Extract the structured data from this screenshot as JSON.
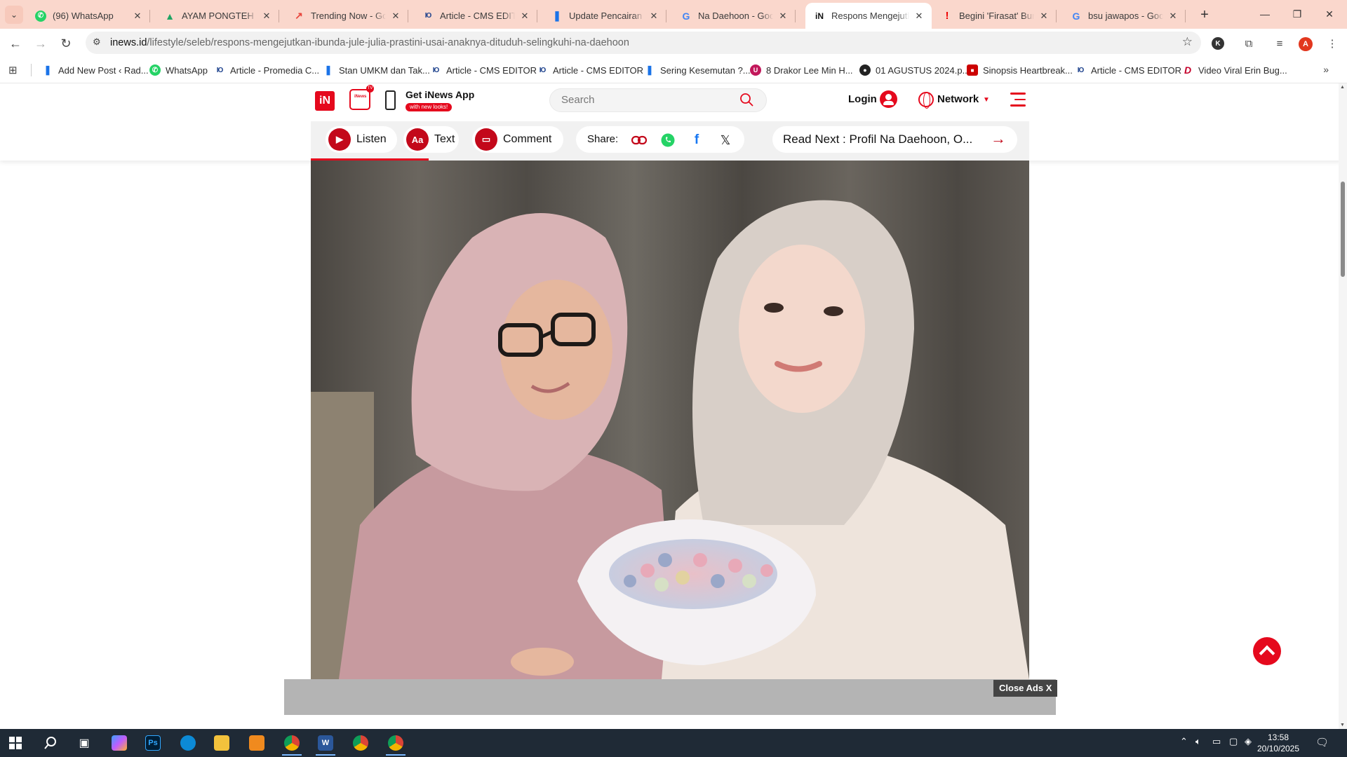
{
  "browser": {
    "tabs": [
      {
        "title": "(96) WhatsApp",
        "favicon": "whatsapp-icon",
        "active": false
      },
      {
        "title": "AYAM PONGTEH - Go",
        "favicon": "google-drive-icon",
        "active": false
      },
      {
        "title": "Trending Now - Goog",
        "favicon": "trends-icon",
        "active": false
      },
      {
        "title": "Article - CMS EDITOR",
        "favicon": "io-logo-icon",
        "active": false
      },
      {
        "title": "Update Pencairan Ba",
        "favicon": "bookmark-icon",
        "active": false
      },
      {
        "title": "Na Daehoon - Googl",
        "favicon": "google-icon",
        "active": false
      },
      {
        "title": "Respons Mengejutka",
        "favicon": "inews-icon",
        "active": true
      },
      {
        "title": "Begini 'Firasat' Buruk",
        "favicon": "exclamation-icon",
        "active": false
      },
      {
        "title": "bsu jawapos - Googl",
        "favicon": "google-icon",
        "active": false
      }
    ],
    "url_domain": "inews.id",
    "url_path": "/lifestyle/seleb/respons-mengejutkan-ibunda-jule-julia-prastini-usai-anaknya-dituduh-selingkuhi-na-daehoon",
    "profile_initial": "A",
    "extension_initial": "K",
    "bookmarks": [
      {
        "label": "Add New Post ‹ Rad...",
        "icon": "wordpress-icon"
      },
      {
        "label": "WhatsApp",
        "icon": "whatsapp-icon"
      },
      {
        "label": "Article - Promedia C...",
        "icon": "io-logo-icon"
      },
      {
        "label": "Stan UMKM dan Tak...",
        "icon": "wordpress-icon"
      },
      {
        "label": "Article - CMS EDITOR",
        "icon": "io-logo-icon"
      },
      {
        "label": "Article - CMS EDITOR",
        "icon": "io-logo-icon"
      },
      {
        "label": "Sering Kesemutan ?...",
        "icon": "wordpress-icon"
      },
      {
        "label": "8 Drakor Lee Min H...",
        "icon": "u-logo-icon"
      },
      {
        "label": "01 AGUSTUS 2024.p...",
        "icon": "circle-logo-icon"
      },
      {
        "label": "Sinopsis Heartbreak...",
        "icon": "news-logo-icon"
      },
      {
        "label": "Article - CMS EDITOR",
        "icon": "io-logo-icon"
      },
      {
        "label": "Video Viral Erin Bug...",
        "icon": "d-logo-icon"
      }
    ]
  },
  "site": {
    "logo_text": "iN",
    "tv_label": "iNews",
    "tv_badge": "TV",
    "get_app": "Get iNews App",
    "new_looks": "with new looks!",
    "search_placeholder": "Search",
    "login": "Login",
    "network": "Network",
    "accent_color": "#e5091d"
  },
  "article_toolbar": {
    "listen": "Listen",
    "text": "Text",
    "text_icon": "Aa",
    "comment": "Comment",
    "share_label": "Share:",
    "read_next": "Read Next : Profil Na Daehoon, O..."
  },
  "ads": {
    "close_label": "Close Ads X"
  },
  "taskbar": {
    "time": "13:58",
    "date": "20/10/2025"
  }
}
